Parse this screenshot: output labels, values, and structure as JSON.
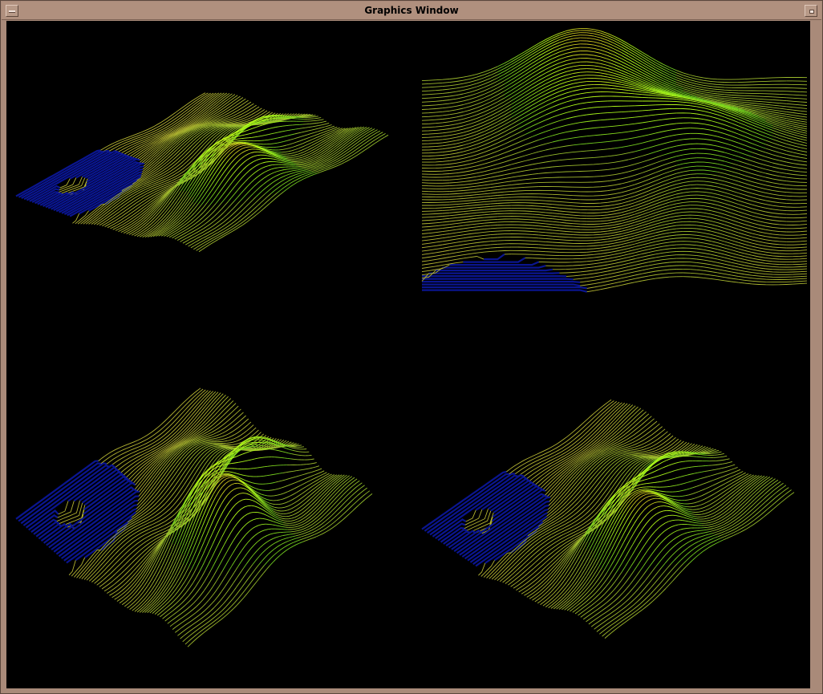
{
  "window": {
    "title": "Graphics Window",
    "menu_icon": "window-menu-icon",
    "maximize_icon": "maximize-icon"
  },
  "scene": {
    "background": "#000000",
    "water_color": "#0a1590",
    "wire_low_color": "#b4b432",
    "wire_mid_color": "#6cc820",
    "ridge_color": "#b8ff18",
    "peak_color": "#e07a28",
    "views": [
      "perspective-front",
      "close-up",
      "perspective-rotated",
      "perspective-side"
    ]
  }
}
